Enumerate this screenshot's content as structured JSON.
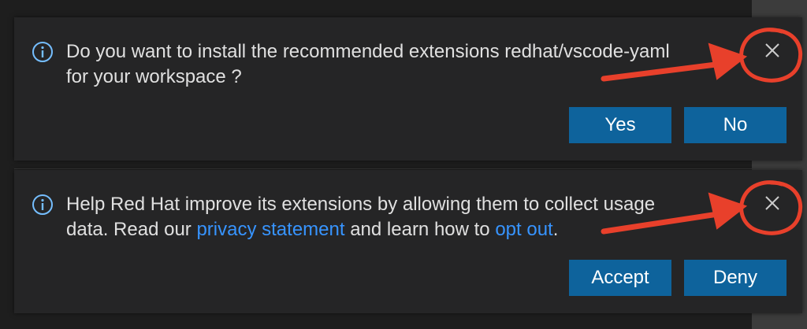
{
  "notifications": [
    {
      "message_part1": "Do you want to install the recommended extensions redhat/vscode-yaml for your workspace ?",
      "primary_label": "Yes",
      "secondary_label": "No",
      "icon": "info-icon",
      "close_icon": "close-icon"
    },
    {
      "message_part1": "Help Red Hat improve its extensions by allowing them to collect usage data. Read our ",
      "link1": "privacy statement",
      "message_part2": " and learn how to ",
      "link2": "opt out",
      "message_part3": ".",
      "primary_label": "Accept",
      "secondary_label": "Deny",
      "icon": "info-icon",
      "close_icon": "close-icon"
    }
  ],
  "colors": {
    "background": "#1e1e1e",
    "toast": "#252526",
    "button": "#0e639c",
    "link": "#3794ff",
    "info": "#75beff",
    "annotation": "#e8402b"
  }
}
